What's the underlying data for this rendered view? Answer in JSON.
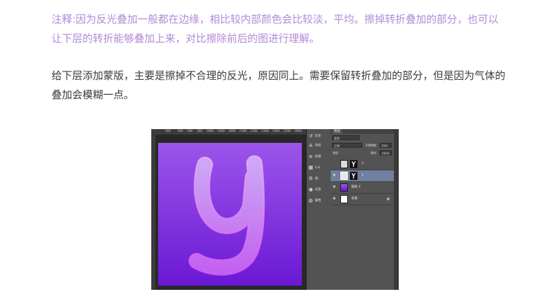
{
  "article": {
    "note": "注释:因为反光叠加一般都在边缘，相比较内部颜色会比较淡，平均。擦掉转折叠加的部分，也可以让下层的转折能够叠加上来，对比擦除前后的图进行理解。",
    "paragraph": "给下层添加蒙版，主要是擦掉不合理的反光，原因同上。需要保留转折叠加的部分，但是因为气体的叠加会模糊一点。"
  },
  "colors": {
    "note_text": "#b08ad8",
    "canvas_top": "#9b55ea",
    "canvas_bottom": "#6a18d4",
    "selected_layer": "#6f7f9f"
  },
  "screenshot": {
    "ruler_ticks": [
      "300",
      "400",
      "500",
      "200",
      "1800",
      "1900",
      "2000",
      "2100",
      "2200",
      "2300",
      "2400",
      "2500",
      "2600"
    ],
    "panel_items": [
      {
        "icon": "history-icon",
        "glyph": "↺",
        "label": "历史"
      },
      {
        "icon": "character-icon",
        "glyph": "A",
        "label": "字符"
      },
      {
        "icon": "paragraph-icon",
        "glyph": "≡",
        "label": "段落"
      },
      {
        "icon": "color-icon",
        "glyph": "▦",
        "label": "Col..."
      },
      {
        "icon": "adjustments-icon",
        "glyph": "⚙",
        "label": "调..."
      },
      {
        "icon": "properties-icon",
        "glyph": "◉",
        "label": "信息"
      },
      {
        "icon": "swatches-icon",
        "glyph": "◍",
        "label": "属性"
      }
    ],
    "layers": {
      "tab_label": "图层",
      "filter_value": "类型",
      "blend_mode": "正常",
      "opacity_label": "不透明度:",
      "opacity_value": "20%",
      "lock_label": "锁定:",
      "fill_label": "填充:",
      "fill_value": "100%",
      "rows": [
        {
          "name": "2",
          "selected": false,
          "has_mask": true
        },
        {
          "name": "1",
          "selected": true,
          "has_mask": true
        },
        {
          "name": "图层 4",
          "selected": false,
          "has_mask": false
        },
        {
          "name": "背景",
          "selected": false,
          "has_mask": false
        }
      ]
    }
  }
}
